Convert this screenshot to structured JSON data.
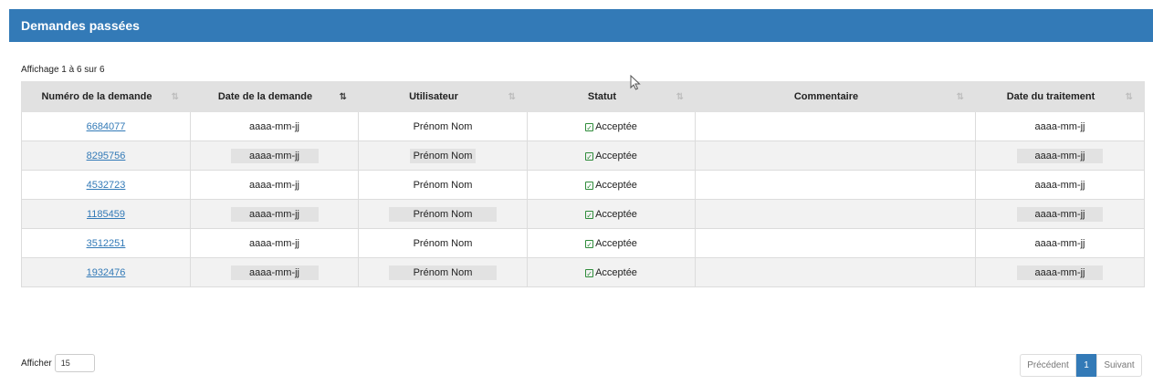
{
  "panel": {
    "title": "Demandes passées"
  },
  "table": {
    "info": "Affichage 1 à 6 sur 6",
    "columns": [
      "Numéro de la demande",
      "Date de la demande",
      "Utilisateur",
      "Statut",
      "Commentaire",
      "Date du traitement"
    ],
    "sorted_column": "Date de la demande",
    "rows": [
      {
        "id": "6684077",
        "date": "aaaa-mm-jj",
        "user": "Prénom Nom",
        "status": "Acceptée",
        "comment": "",
        "processed": "aaaa-mm-jj"
      },
      {
        "id": "8295756",
        "date": "aaaa-mm-jj",
        "user": "Prénom Nom",
        "status": "Acceptée",
        "comment": "",
        "processed": "aaaa-mm-jj"
      },
      {
        "id": "4532723",
        "date": "aaaa-mm-jj",
        "user": "Prénom Nom",
        "status": "Acceptée",
        "comment": "",
        "processed": "aaaa-mm-jj"
      },
      {
        "id": "1185459",
        "date": "aaaa-mm-jj",
        "user": "Prénom Nom",
        "status": "Acceptée",
        "comment": "",
        "processed": "aaaa-mm-jj"
      },
      {
        "id": "3512251",
        "date": "aaaa-mm-jj",
        "user": "Prénom Nom",
        "status": "Acceptée",
        "comment": "",
        "processed": "aaaa-mm-jj"
      },
      {
        "id": "1932476",
        "date": "aaaa-mm-jj",
        "user": "Prénom Nom",
        "status": "Acceptée",
        "comment": "",
        "processed": "aaaa-mm-jj"
      }
    ]
  },
  "length": {
    "label": "Afficher",
    "value": "15"
  },
  "pagination": {
    "prev": "Précédent",
    "current": "1",
    "next": "Suivant"
  },
  "colors": {
    "header_blue": "#337ab7",
    "status_green": "#2e8b3a",
    "row_stripe": "#f2f2f2"
  },
  "icons": {
    "status": "calendar-check-icon",
    "sort": "sort-icon",
    "cursor": "mouse-pointer-icon"
  }
}
